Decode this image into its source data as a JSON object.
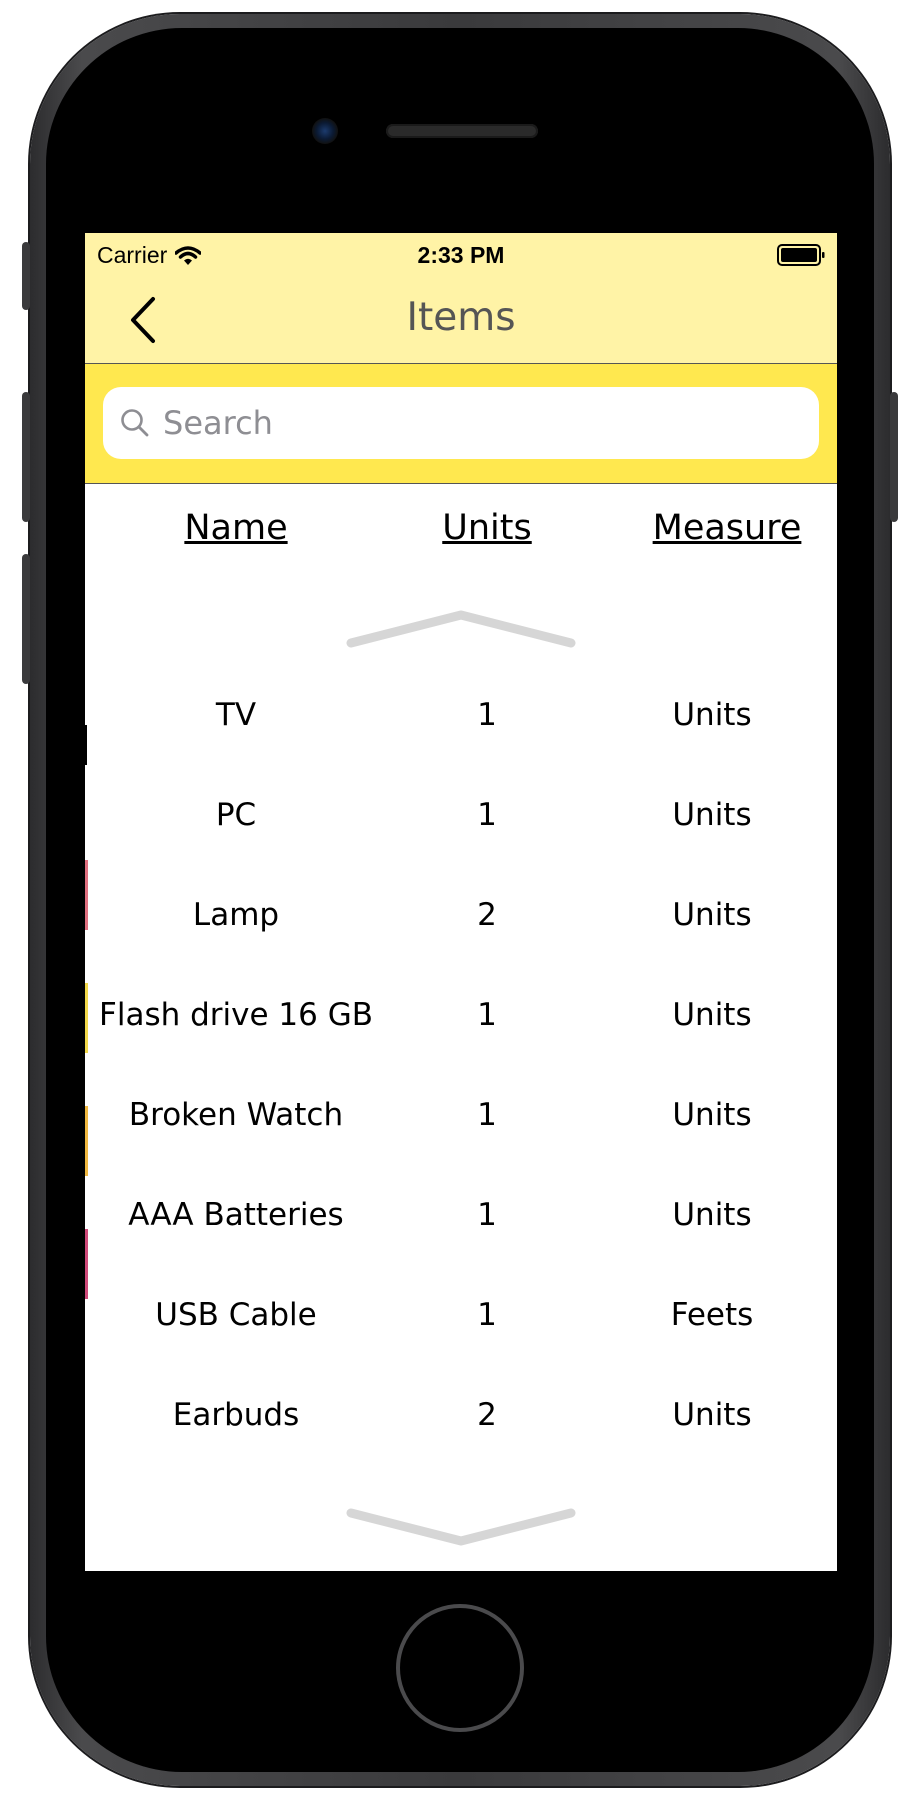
{
  "status_bar": {
    "carrier": "Carrier",
    "time": "2:33 PM",
    "icons": [
      "wifi-icon",
      "battery-icon"
    ]
  },
  "nav": {
    "title": "Items",
    "back_icon": "chevron-left-icon"
  },
  "search": {
    "placeholder": "Search",
    "value": "",
    "icon": "magnifier-icon"
  },
  "table": {
    "columns": [
      "Name",
      "Units",
      "Measure"
    ],
    "rows": [
      {
        "name": "TV",
        "units": "1",
        "measure": "Units"
      },
      {
        "name": "PC",
        "units": "1",
        "measure": "Units"
      },
      {
        "name": "Lamp",
        "units": "2",
        "measure": "Units"
      },
      {
        "name": "Flash drive 16 GB",
        "units": "1",
        "measure": "Units"
      },
      {
        "name": "Broken Watch",
        "units": "1",
        "measure": "Units"
      },
      {
        "name": "AAA Batteries",
        "units": "1",
        "measure": "Units"
      },
      {
        "name": "USB Cable",
        "units": "1",
        "measure": "Feets"
      },
      {
        "name": "Earbuds",
        "units": "2",
        "measure": "Units"
      }
    ],
    "scroll_indicators": [
      "chevron-up-icon",
      "chevron-down-icon"
    ]
  },
  "colors": {
    "nav_background": "#fff3a6",
    "search_background": "#ffe84f",
    "text": "#000000",
    "title_text": "#555555",
    "chevron": "#d6d6d6"
  }
}
